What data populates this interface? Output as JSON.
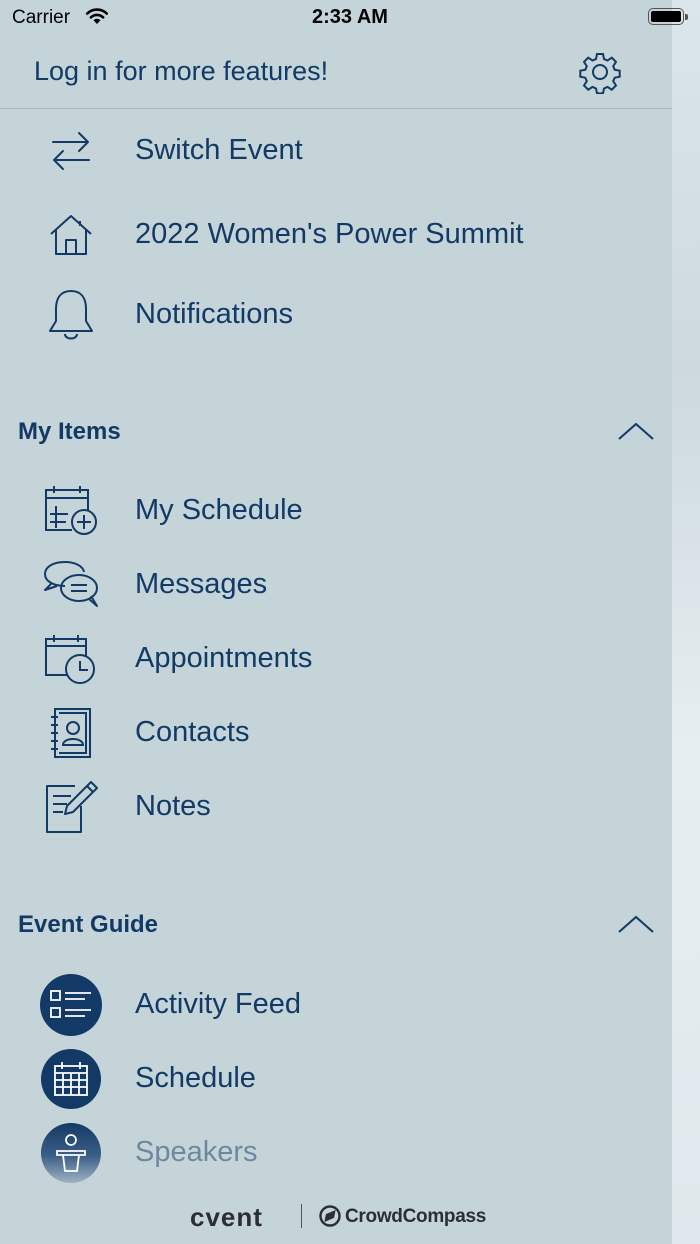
{
  "status_bar": {
    "carrier": "Carrier",
    "time": "2:33 AM"
  },
  "header": {
    "login_text": "Log in for more features!",
    "settings_icon": "gear-icon"
  },
  "top_items": [
    {
      "label": "Switch Event",
      "icon": "switch-arrows-icon"
    },
    {
      "label": "2022 Women's Power Summit",
      "icon": "home-icon"
    },
    {
      "label": "Notifications",
      "icon": "bell-icon"
    }
  ],
  "my_items": {
    "title": "My Items",
    "items": [
      {
        "label": "My Schedule",
        "icon": "calendar-add-icon"
      },
      {
        "label": "Messages",
        "icon": "chat-bubbles-icon"
      },
      {
        "label": "Appointments",
        "icon": "calendar-clock-icon"
      },
      {
        "label": "Contacts",
        "icon": "contact-book-icon"
      },
      {
        "label": "Notes",
        "icon": "notes-pencil-icon"
      }
    ]
  },
  "event_guide": {
    "title": "Event Guide",
    "items": [
      {
        "label": "Activity Feed",
        "icon": "list-icon"
      },
      {
        "label": "Schedule",
        "icon": "calendar-grid-icon"
      },
      {
        "label": "Speakers",
        "icon": "speaker-podium-icon"
      }
    ]
  },
  "footer": {
    "brand_primary": "cvent",
    "brand_secondary": "CrowdCompass"
  },
  "colors": {
    "background": "#c4d4d8",
    "accent": "#133a66"
  }
}
